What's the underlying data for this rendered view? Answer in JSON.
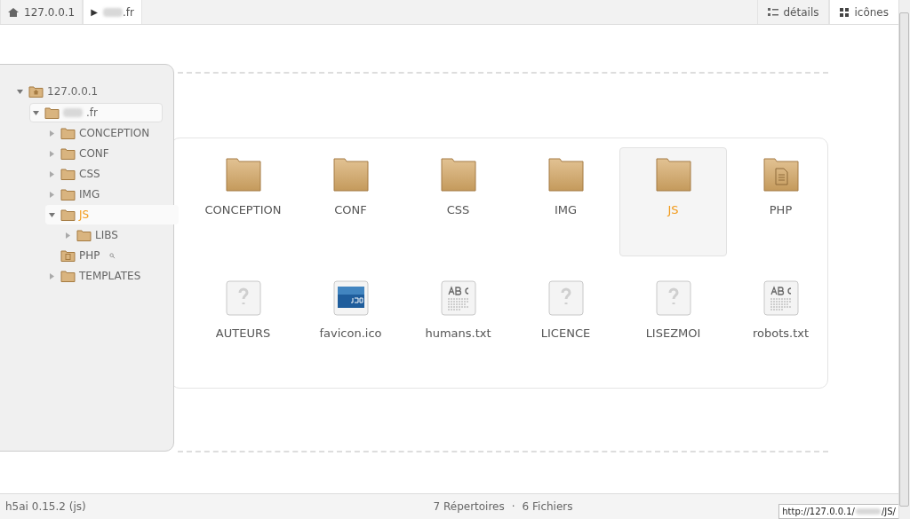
{
  "breadcrumbs": [
    {
      "kind": "home",
      "label": "127.0.0.1",
      "selected": false
    },
    {
      "kind": "folder",
      "arrow": "▶",
      "label": ".fr",
      "selected": true
    }
  ],
  "view_modes": [
    {
      "kind": "details",
      "label": "détails",
      "selected": false
    },
    {
      "kind": "icons",
      "label": "icônes",
      "selected": true
    }
  ],
  "tree": [
    {
      "kind": "home",
      "label": "127.0.0.1",
      "expanded": true,
      "selected": false,
      "children": [
        {
          "kind": "site",
          "label": ".fr",
          "expanded": true,
          "selected": false,
          "children": [
            {
              "kind": "folder",
              "label": "CONCEPTION",
              "expanded": false,
              "selected": false
            },
            {
              "kind": "folder",
              "label": "CONF",
              "expanded": false,
              "selected": false
            },
            {
              "kind": "folder",
              "label": "CSS",
              "expanded": false,
              "selected": false
            },
            {
              "kind": "folder",
              "label": "IMG",
              "expanded": false,
              "selected": false
            },
            {
              "kind": "folder",
              "label": "JS",
              "expanded": true,
              "selected": true,
              "children": [
                {
                  "kind": "folder",
                  "label": "LIBS",
                  "expanded": false,
                  "selected": false
                }
              ]
            },
            {
              "kind": "php",
              "label": "PHP",
              "selected": false
            },
            {
              "kind": "folder",
              "label": "TEMPLATES",
              "expanded": false,
              "selected": false
            }
          ]
        }
      ]
    }
  ],
  "items": [
    {
      "kind": "folder",
      "label": "CONCEPTION",
      "selected": false
    },
    {
      "kind": "folder",
      "label": "CONF",
      "selected": false
    },
    {
      "kind": "folder",
      "label": "CSS",
      "selected": false
    },
    {
      "kind": "folder",
      "label": "IMG",
      "selected": false
    },
    {
      "kind": "folder",
      "label": "JS",
      "selected": true
    },
    {
      "kind": "php",
      "label": "PHP",
      "selected": false
    },
    {
      "kind": "unknown",
      "label": "AUTEURS",
      "selected": false
    },
    {
      "kind": "image",
      "label": "favicon.ico",
      "selected": false
    },
    {
      "kind": "text",
      "label": "humans.txt",
      "selected": false
    },
    {
      "kind": "unknown",
      "label": "LICENCE",
      "selected": false
    },
    {
      "kind": "unknown",
      "label": "LISEZMOI",
      "selected": false
    },
    {
      "kind": "text",
      "label": "robots.txt",
      "selected": false
    }
  ],
  "status_bar": {
    "version": "h5ai 0.15.2 (js)",
    "folders": "7 Répertoires",
    "separator": "·",
    "files": "6 Fichiers"
  },
  "link_tooltip": {
    "prefix": "http://127.0.0.1/",
    "suffix": "/JS/"
  }
}
